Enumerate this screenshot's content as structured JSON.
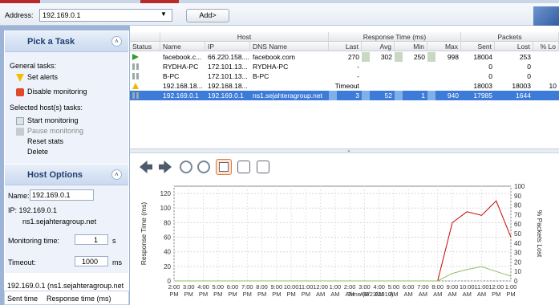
{
  "address": {
    "label": "Address:",
    "value": "192.169.0.1",
    "add_label": "Add>"
  },
  "tasks": {
    "title": "Pick a Task",
    "general_label": "General tasks:",
    "set_alerts": "Set alerts",
    "disable_monitoring": "Disable monitoring",
    "selected_label": "Selected host(s) tasks:",
    "start_monitoring": "Start monitoring",
    "pause_monitoring": "Pause monitoring",
    "reset_stats": "Reset stats",
    "delete": "Delete"
  },
  "host_options": {
    "title": "Host Options",
    "name_label": "Name:",
    "name_value": "192.169.0.1",
    "ip_line": "IP: 192.169.0.1",
    "dns_line": "ns1.sejahteragroup.net",
    "monitoring_label": "Monitoring time:",
    "monitoring_value": "1",
    "monitoring_unit": "s",
    "timeout_label": "Timeout:",
    "timeout_value": "1000",
    "timeout_unit": "ms"
  },
  "log": {
    "title": "192.169.0.1 (ns1.sejahteragroup.net",
    "col_sent": "Sent time",
    "col_resp": "Response time (ms)"
  },
  "table": {
    "groups": {
      "host": "Host",
      "response": "Response Time (ms)",
      "packets": "Packets"
    },
    "columns": {
      "status": "Status",
      "name": "Name",
      "ip": "IP",
      "dns": "DNS Name",
      "last": "Last",
      "avg": "Avg",
      "min": "Min",
      "max": "Max",
      "sent": "Sent",
      "lost": "Lost",
      "lost_pct": "% Lo"
    },
    "rows": [
      {
        "status": "play",
        "name": "facebook.c...",
        "ip": "66.220.158....",
        "dns": "facebook.com",
        "last": "270",
        "avg": "302",
        "min": "250",
        "max": "998",
        "sent": "18004",
        "lost": "253",
        "pct": ""
      },
      {
        "status": "pause",
        "name": "RYDHA-PC",
        "ip": "172.101.13...",
        "dns": "RYDHA-PC",
        "last": "-",
        "avg": "",
        "min": "",
        "max": "",
        "sent": "0",
        "lost": "0",
        "pct": ""
      },
      {
        "status": "pause",
        "name": "B-PC",
        "ip": "172.101.13...",
        "dns": "B-PC",
        "last": "-",
        "avg": "",
        "min": "",
        "max": "",
        "sent": "0",
        "lost": "0",
        "pct": ""
      },
      {
        "status": "warn",
        "name": "192.168.18...",
        "ip": "192.168.18...",
        "dns": "",
        "last": "Timeout",
        "avg": "",
        "min": "",
        "max": "",
        "sent": "18003",
        "lost": "18003",
        "pct": "10"
      },
      {
        "status": "pause",
        "name": "192.169.0.1",
        "ip": "192.169.0.1",
        "dns": "ns1.sejahteragroup.net",
        "last": "3",
        "avg": "52",
        "min": "1",
        "max": "940",
        "sent": "17985",
        "lost": "1644",
        "pct": ""
      }
    ]
  },
  "chart_data": {
    "type": "line",
    "ylabel": "Response Time (ms)",
    "y2label": "% Packets Lost",
    "ylim": [
      0,
      130
    ],
    "y2lim": [
      0,
      100
    ],
    "yticks": [
      0,
      20,
      40,
      60,
      80,
      100,
      120
    ],
    "y2ticks": [
      0,
      10,
      20,
      30,
      40,
      50,
      60,
      70,
      80,
      90,
      100
    ],
    "xticks": [
      "2:00 PM",
      "3:00 PM",
      "4:00 PM",
      "5:00 PM",
      "6:00 PM",
      "7:00 PM",
      "8:00 PM",
      "9:00 PM",
      "10:00 PM",
      "11:00 PM",
      "12:00 AM",
      "1:00 AM",
      "2:00 AM",
      "3:00 AM",
      "4:00 AM",
      "5:00 AM",
      "6:00 AM",
      "7:00 AM",
      "8:00 AM",
      "9:00 AM",
      "10:00 AM",
      "11:00 AM",
      "12:00 PM",
      "1:00 PM"
    ],
    "xlabel": "Time (8/23/2010)",
    "series": [
      {
        "values": [
          0,
          0,
          0,
          0,
          0,
          0,
          0,
          0,
          0,
          0,
          0,
          0,
          0,
          0,
          0,
          0,
          0,
          0,
          0,
          80,
          95,
          90,
          110,
          60
        ]
      },
      {
        "values": [
          0,
          0,
          0,
          0,
          0,
          0,
          0,
          0,
          0,
          0,
          0,
          0,
          0,
          0,
          0,
          0,
          0,
          0,
          0,
          8,
          12,
          15,
          10,
          5
        ]
      }
    ],
    "colors": {
      "response": "#cc0000",
      "lost": "#90c060"
    }
  }
}
